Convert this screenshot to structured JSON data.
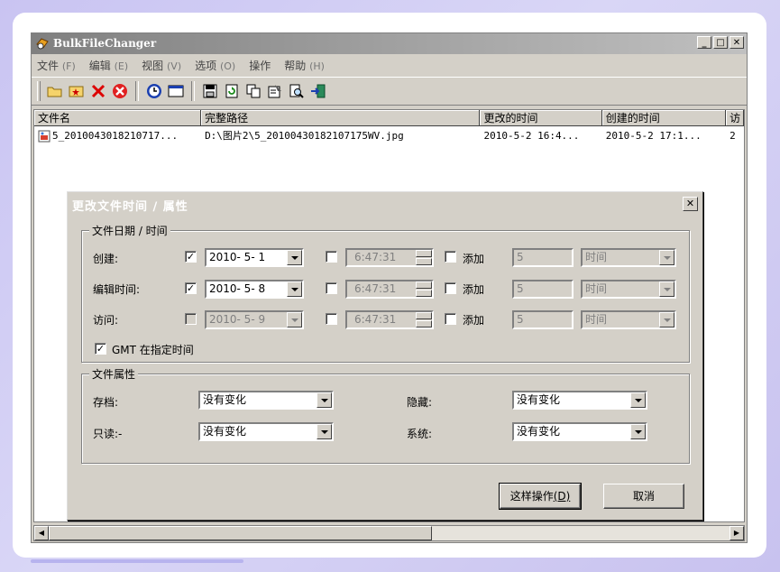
{
  "app": {
    "title": "BulkFileChanger"
  },
  "menu": [
    {
      "label": "文件",
      "acc": "(F)"
    },
    {
      "label": "编辑",
      "acc": "(E)"
    },
    {
      "label": "视图",
      "acc": "(V)"
    },
    {
      "label": "选项",
      "acc": "(O)"
    },
    {
      "label": "操作",
      "acc": ""
    },
    {
      "label": "帮助",
      "acc": "(H)"
    }
  ],
  "list": {
    "columns": [
      "文件名",
      "完整路径",
      "更改的时间",
      "创建的时间",
      "访"
    ],
    "rows": [
      [
        "5_2010043018210717...",
        "D:\\图片2\\5_20100430182107175WV.jpg",
        "2010-5-2 16:4...",
        "2010-5-2 17:1...",
        "2"
      ]
    ]
  },
  "dialog": {
    "title": "更改文件时间 / 属性",
    "date_group": {
      "label": "文件日期 / 时间",
      "rows": [
        {
          "label": "创建:",
          "date": "2010- 5- 1",
          "time": "6:47:31",
          "add_label": "添加",
          "add_value": "5",
          "unit": "时间"
        },
        {
          "label": "编辑时间:",
          "date": "2010- 5- 8",
          "time": "6:47:31",
          "add_label": "添加",
          "add_value": "5",
          "unit": "时间"
        },
        {
          "label": "访问:",
          "date": "2010- 5- 9",
          "time": "6:47:31",
          "add_label": "添加",
          "add_value": "5",
          "unit": "时间"
        }
      ],
      "gmt_label": "GMT 在指定时间"
    },
    "attr_group": {
      "label": "文件属性",
      "archive_label": "存档:",
      "archive_value": "没有变化",
      "readonly_label": "只读:-",
      "readonly_value": "没有变化",
      "hidden_label": "隐藏:",
      "hidden_value": "没有变化",
      "system_label": "系统:",
      "system_value": "没有变化"
    },
    "do_it_label": "这样操作",
    "do_it_acc": "(D)",
    "cancel_label": "取消"
  }
}
